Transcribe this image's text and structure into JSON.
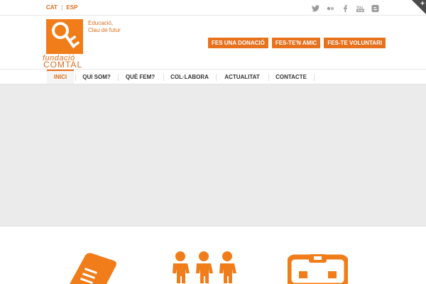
{
  "topbar": {
    "lang_cat": "CAT",
    "lang_sep": "|",
    "lang_esp": "ESP",
    "social_icons": [
      "twitter-icon",
      "flickr-icon",
      "facebook-icon",
      "youtube-icon",
      "blogger-icon"
    ]
  },
  "logo": {
    "line1": "fundació",
    "line2": "COMTAL"
  },
  "tagline": {
    "line1": "Educació,",
    "line2": "Clau de futur"
  },
  "actions": {
    "donate": "FES UNA DONACIÓ",
    "friend": "FES-TE'N AMIC",
    "volunteer": "FES-TE VOLUNTARI"
  },
  "nav": {
    "items": [
      "INICI",
      "QUI SOM?",
      "QUÈ FEM?",
      "COL·LABORA",
      "ACTUALITAT",
      "CONTACTE"
    ]
  },
  "colors": {
    "brand": "#e8711e",
    "slider_bg": "#ebebeb"
  }
}
